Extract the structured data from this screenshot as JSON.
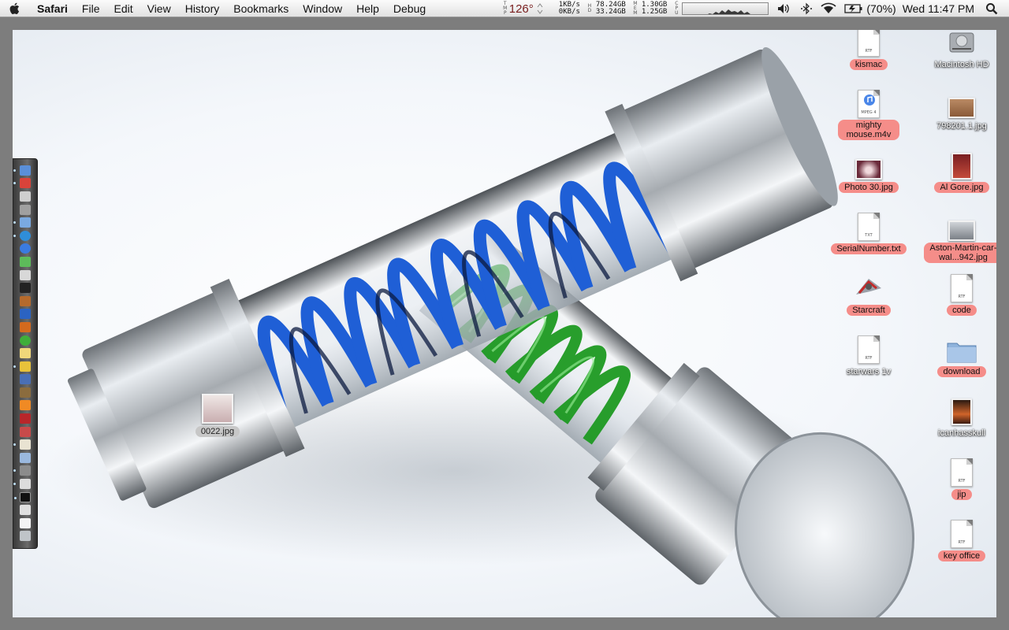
{
  "menubar": {
    "items": [
      "Safari",
      "File",
      "Edit",
      "View",
      "History",
      "Bookmarks",
      "Window",
      "Help",
      "Debug"
    ]
  },
  "status": {
    "tmp_label": "TMP",
    "temperature": "126°",
    "net_up": "1KB/s",
    "net_down": "0KB/s",
    "hd_label": "HD",
    "hd_used": "78.24GB",
    "hd_free": "33.24GB",
    "mem_label": "MEM",
    "mem_used": "1.30GB",
    "mem_free": "1.25GB",
    "cpu_label": "CPU",
    "battery": "(70%)",
    "clock": "Wed 11:47 PM"
  },
  "desktop_icons": [
    {
      "label": "kismac",
      "kind": "rtf",
      "selected": true
    },
    {
      "label": "Macintosh HD",
      "kind": "hd",
      "selected": false
    },
    {
      "label": "mighty mouse.m4v",
      "kind": "mpeg4",
      "selected": true
    },
    {
      "label": "798201.1.jpg",
      "kind": "image",
      "selected": false
    },
    {
      "label": "Photo 30.jpg",
      "kind": "image",
      "selected": true
    },
    {
      "label": "Al Gore.jpg",
      "kind": "image",
      "selected": true
    },
    {
      "label": "SerialNumber.txt",
      "kind": "txt",
      "selected": true
    },
    {
      "label": "Aston-Martin-car-wal...942.jpg",
      "kind": "image",
      "selected": true
    },
    {
      "label": "Starcraft",
      "kind": "app",
      "selected": true
    },
    {
      "label": "code",
      "kind": "rtf",
      "selected": true
    },
    {
      "label": "starwars 1v",
      "kind": "rtf",
      "selected": false
    },
    {
      "label": "download",
      "kind": "folder",
      "selected": true
    },
    {
      "label": "icanhasskull",
      "kind": "image",
      "selected": false
    },
    {
      "label": "jip",
      "kind": "rtf",
      "selected": true
    },
    {
      "label": "key office",
      "kind": "rtf",
      "selected": true
    },
    {
      "label": "0022.jpg",
      "kind": "image",
      "selected": false
    }
  ],
  "doc_tags": {
    "rtf": "RTF",
    "txt": "TXT",
    "mpeg": "MPEG 4"
  },
  "colors": {
    "selection": "#f58d89",
    "accent_blue": "#1f5fd6",
    "accent_green": "#2fa12f",
    "metal": "#c9cdd2"
  }
}
